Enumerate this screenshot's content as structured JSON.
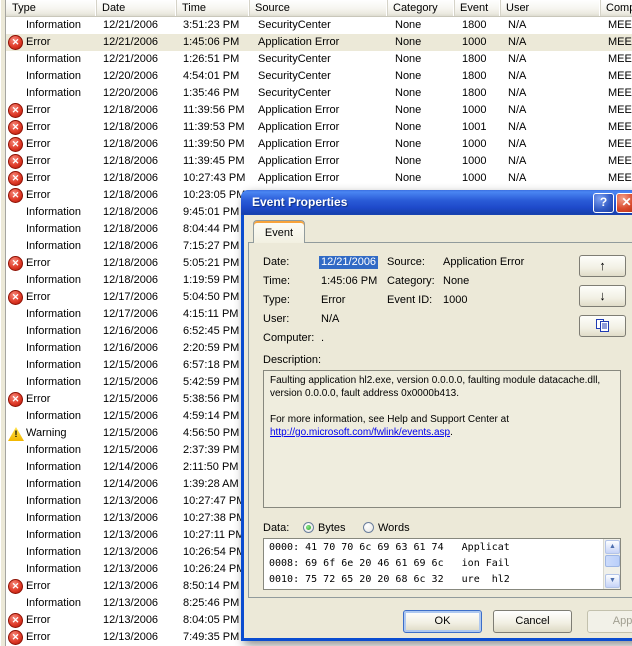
{
  "colors": {
    "titlebar_blue": "#2A5BD7",
    "dialog_beige": "#ECE9D8",
    "selection_highlight": "#316AC5",
    "link_blue": "#0000EE",
    "error_red": "#C81E14",
    "warning_yellow": "#F2B600",
    "info_blue": "#1037C8",
    "tab_accent_orange": "#F8A33A"
  },
  "icons": {
    "information": "balloon-i",
    "error": "circle-x",
    "warning": "triangle-exclamation",
    "help": "?",
    "close": "✕",
    "up_arrow": "↑",
    "down_arrow": "↓",
    "copy": "copy-pages"
  },
  "events": {
    "columns": [
      "Type",
      "Date",
      "Time",
      "Source",
      "Category",
      "Event",
      "User",
      "Comp"
    ],
    "rows": [
      {
        "type": "Information",
        "date": "12/21/2006",
        "time": "3:51:23 PM",
        "source": "SecurityCenter",
        "category": "None",
        "event": "1800",
        "user": "N/A",
        "computer": "MEEK",
        "selected": false
      },
      {
        "type": "Error",
        "date": "12/21/2006",
        "time": "1:45:06 PM",
        "source": "Application Error",
        "category": "None",
        "event": "1000",
        "user": "N/A",
        "computer": "MEEK",
        "selected": true
      },
      {
        "type": "Information",
        "date": "12/21/2006",
        "time": "1:26:51 PM",
        "source": "SecurityCenter",
        "category": "None",
        "event": "1800",
        "user": "N/A",
        "computer": "MEEK",
        "selected": false
      },
      {
        "type": "Information",
        "date": "12/20/2006",
        "time": "4:54:01 PM",
        "source": "SecurityCenter",
        "category": "None",
        "event": "1800",
        "user": "N/A",
        "computer": "MEEK",
        "selected": false
      },
      {
        "type": "Information",
        "date": "12/20/2006",
        "time": "1:35:46 PM",
        "source": "SecurityCenter",
        "category": "None",
        "event": "1800",
        "user": "N/A",
        "computer": "MEEK",
        "selected": false
      },
      {
        "type": "Error",
        "date": "12/18/2006",
        "time": "11:39:56 PM",
        "source": "Application Error",
        "category": "None",
        "event": "1000",
        "user": "N/A",
        "computer": "MEEK",
        "selected": false
      },
      {
        "type": "Error",
        "date": "12/18/2006",
        "time": "11:39:53 PM",
        "source": "Application Error",
        "category": "None",
        "event": "1001",
        "user": "N/A",
        "computer": "MEEK",
        "selected": false
      },
      {
        "type": "Error",
        "date": "12/18/2006",
        "time": "11:39:50 PM",
        "source": "Application Error",
        "category": "None",
        "event": "1000",
        "user": "N/A",
        "computer": "MEEK",
        "selected": false
      },
      {
        "type": "Error",
        "date": "12/18/2006",
        "time": "11:39:45 PM",
        "source": "Application Error",
        "category": "None",
        "event": "1000",
        "user": "N/A",
        "computer": "MEEK",
        "selected": false
      },
      {
        "type": "Error",
        "date": "12/18/2006",
        "time": "10:27:43 PM",
        "source": "Application Error",
        "category": "None",
        "event": "1000",
        "user": "N/A",
        "computer": "MEEK",
        "selected": false
      },
      {
        "type": "Error",
        "date": "12/18/2006",
        "time": "10:23:05 PM",
        "source": "",
        "category": "",
        "event": "",
        "user": "",
        "computer": "",
        "selected": false
      },
      {
        "type": "Information",
        "date": "12/18/2006",
        "time": "9:45:01 PM",
        "source": "",
        "category": "",
        "event": "",
        "user": "",
        "computer": "",
        "selected": false
      },
      {
        "type": "Information",
        "date": "12/18/2006",
        "time": "8:04:44 PM",
        "source": "",
        "category": "",
        "event": "",
        "user": "",
        "computer": "",
        "selected": false
      },
      {
        "type": "Information",
        "date": "12/18/2006",
        "time": "7:15:27 PM",
        "source": "",
        "category": "",
        "event": "",
        "user": "",
        "computer": "",
        "selected": false
      },
      {
        "type": "Error",
        "date": "12/18/2006",
        "time": "5:05:21 PM",
        "source": "",
        "category": "",
        "event": "",
        "user": "",
        "computer": "",
        "selected": false
      },
      {
        "type": "Information",
        "date": "12/18/2006",
        "time": "1:19:59 PM",
        "source": "",
        "category": "",
        "event": "",
        "user": "",
        "computer": "",
        "selected": false
      },
      {
        "type": "Error",
        "date": "12/17/2006",
        "time": "5:04:50 PM",
        "source": "",
        "category": "",
        "event": "",
        "user": "",
        "computer": "",
        "selected": false
      },
      {
        "type": "Information",
        "date": "12/17/2006",
        "time": "4:15:11 PM",
        "source": "",
        "category": "",
        "event": "",
        "user": "",
        "computer": "",
        "selected": false
      },
      {
        "type": "Information",
        "date": "12/16/2006",
        "time": "6:52:45 PM",
        "source": "",
        "category": "",
        "event": "",
        "user": "",
        "computer": "",
        "selected": false
      },
      {
        "type": "Information",
        "date": "12/16/2006",
        "time": "2:20:59 PM",
        "source": "",
        "category": "",
        "event": "",
        "user": "",
        "computer": "",
        "selected": false
      },
      {
        "type": "Information",
        "date": "12/15/2006",
        "time": "6:57:18 PM",
        "source": "",
        "category": "",
        "event": "",
        "user": "",
        "computer": "",
        "selected": false
      },
      {
        "type": "Information",
        "date": "12/15/2006",
        "time": "5:42:59 PM",
        "source": "",
        "category": "",
        "event": "",
        "user": "",
        "computer": "",
        "selected": false
      },
      {
        "type": "Error",
        "date": "12/15/2006",
        "time": "5:38:56 PM",
        "source": "",
        "category": "",
        "event": "",
        "user": "",
        "computer": "",
        "selected": false
      },
      {
        "type": "Information",
        "date": "12/15/2006",
        "time": "4:59:14 PM",
        "source": "",
        "category": "",
        "event": "",
        "user": "",
        "computer": "",
        "selected": false
      },
      {
        "type": "Warning",
        "date": "12/15/2006",
        "time": "4:56:50 PM",
        "source": "",
        "category": "",
        "event": "",
        "user": "",
        "computer": "",
        "selected": false
      },
      {
        "type": "Information",
        "date": "12/15/2006",
        "time": "2:37:39 PM",
        "source": "",
        "category": "",
        "event": "",
        "user": "",
        "computer": "",
        "selected": false
      },
      {
        "type": "Information",
        "date": "12/14/2006",
        "time": "2:11:50 PM",
        "source": "",
        "category": "",
        "event": "",
        "user": "",
        "computer": "",
        "selected": false
      },
      {
        "type": "Information",
        "date": "12/14/2006",
        "time": "1:39:28 AM",
        "source": "",
        "category": "",
        "event": "",
        "user": "",
        "computer": "",
        "selected": false
      },
      {
        "type": "Information",
        "date": "12/13/2006",
        "time": "10:27:47 PM",
        "source": "",
        "category": "",
        "event": "",
        "user": "",
        "computer": "",
        "selected": false
      },
      {
        "type": "Information",
        "date": "12/13/2006",
        "time": "10:27:38 PM",
        "source": "",
        "category": "",
        "event": "",
        "user": "",
        "computer": "",
        "selected": false
      },
      {
        "type": "Information",
        "date": "12/13/2006",
        "time": "10:27:11 PM",
        "source": "",
        "category": "",
        "event": "",
        "user": "",
        "computer": "",
        "selected": false
      },
      {
        "type": "Information",
        "date": "12/13/2006",
        "time": "10:26:54 PM",
        "source": "",
        "category": "",
        "event": "",
        "user": "",
        "computer": "",
        "selected": false
      },
      {
        "type": "Information",
        "date": "12/13/2006",
        "time": "10:26:24 PM",
        "source": "",
        "category": "",
        "event": "",
        "user": "",
        "computer": "",
        "selected": false
      },
      {
        "type": "Error",
        "date": "12/13/2006",
        "time": "8:50:14 PM",
        "source": "",
        "category": "",
        "event": "",
        "user": "",
        "computer": "",
        "selected": false
      },
      {
        "type": "Information",
        "date": "12/13/2006",
        "time": "8:25:46 PM",
        "source": "",
        "category": "",
        "event": "",
        "user": "",
        "computer": "",
        "selected": false
      },
      {
        "type": "Error",
        "date": "12/13/2006",
        "time": "8:04:05 PM",
        "source": "",
        "category": "",
        "event": "",
        "user": "",
        "computer": "",
        "selected": false
      },
      {
        "type": "Error",
        "date": "12/13/2006",
        "time": "7:49:35 PM",
        "source": "",
        "category": "",
        "event": "",
        "user": "",
        "computer": "",
        "selected": false
      }
    ]
  },
  "dialog": {
    "title": "Event Properties",
    "titlebar": {
      "help": "?",
      "close": "✕"
    },
    "tab_label": "Event",
    "fields": {
      "date_label": "Date:",
      "date_value": "12/21/2006",
      "time_label": "Time:",
      "time_value": "1:45:06 PM",
      "type_label": "Type:",
      "type_value": "Error",
      "user_label": "User:",
      "user_value": "N/A",
      "computer_label": "Computer:",
      "computer_value": ".",
      "source_label": "Source:",
      "source_value": "Application Error",
      "category_label": "Category:",
      "category_value": "None",
      "event_id_label": "Event ID:",
      "event_id_value": "1000"
    },
    "nav": {
      "up": "↑",
      "down": "↓"
    },
    "description_label": "Description:",
    "description": {
      "para1": "Faulting application hl2.exe, version 0.0.0.0, faulting module datacache.dll, version 0.0.0.0, fault address 0x0000b413.",
      "para2": "For more information, see Help and Support Center at",
      "link": "http://go.microsoft.com/fwlink/events.asp",
      "after_link": "."
    },
    "data_section": {
      "label": "Data:",
      "bytes_label": "Bytes",
      "words_label": "Words",
      "selected_radio": "Bytes",
      "lines": [
        "0000: 41 70 70 6c 69 63 61 74   Applicat",
        "0008: 69 6f 6e 20 46 61 69 6c   ion Fail",
        "0010: 75 72 65 20 20 68 6c 32   ure  hl2"
      ]
    },
    "buttons": {
      "ok": "OK",
      "cancel": "Cancel",
      "apply": "Apply"
    }
  }
}
